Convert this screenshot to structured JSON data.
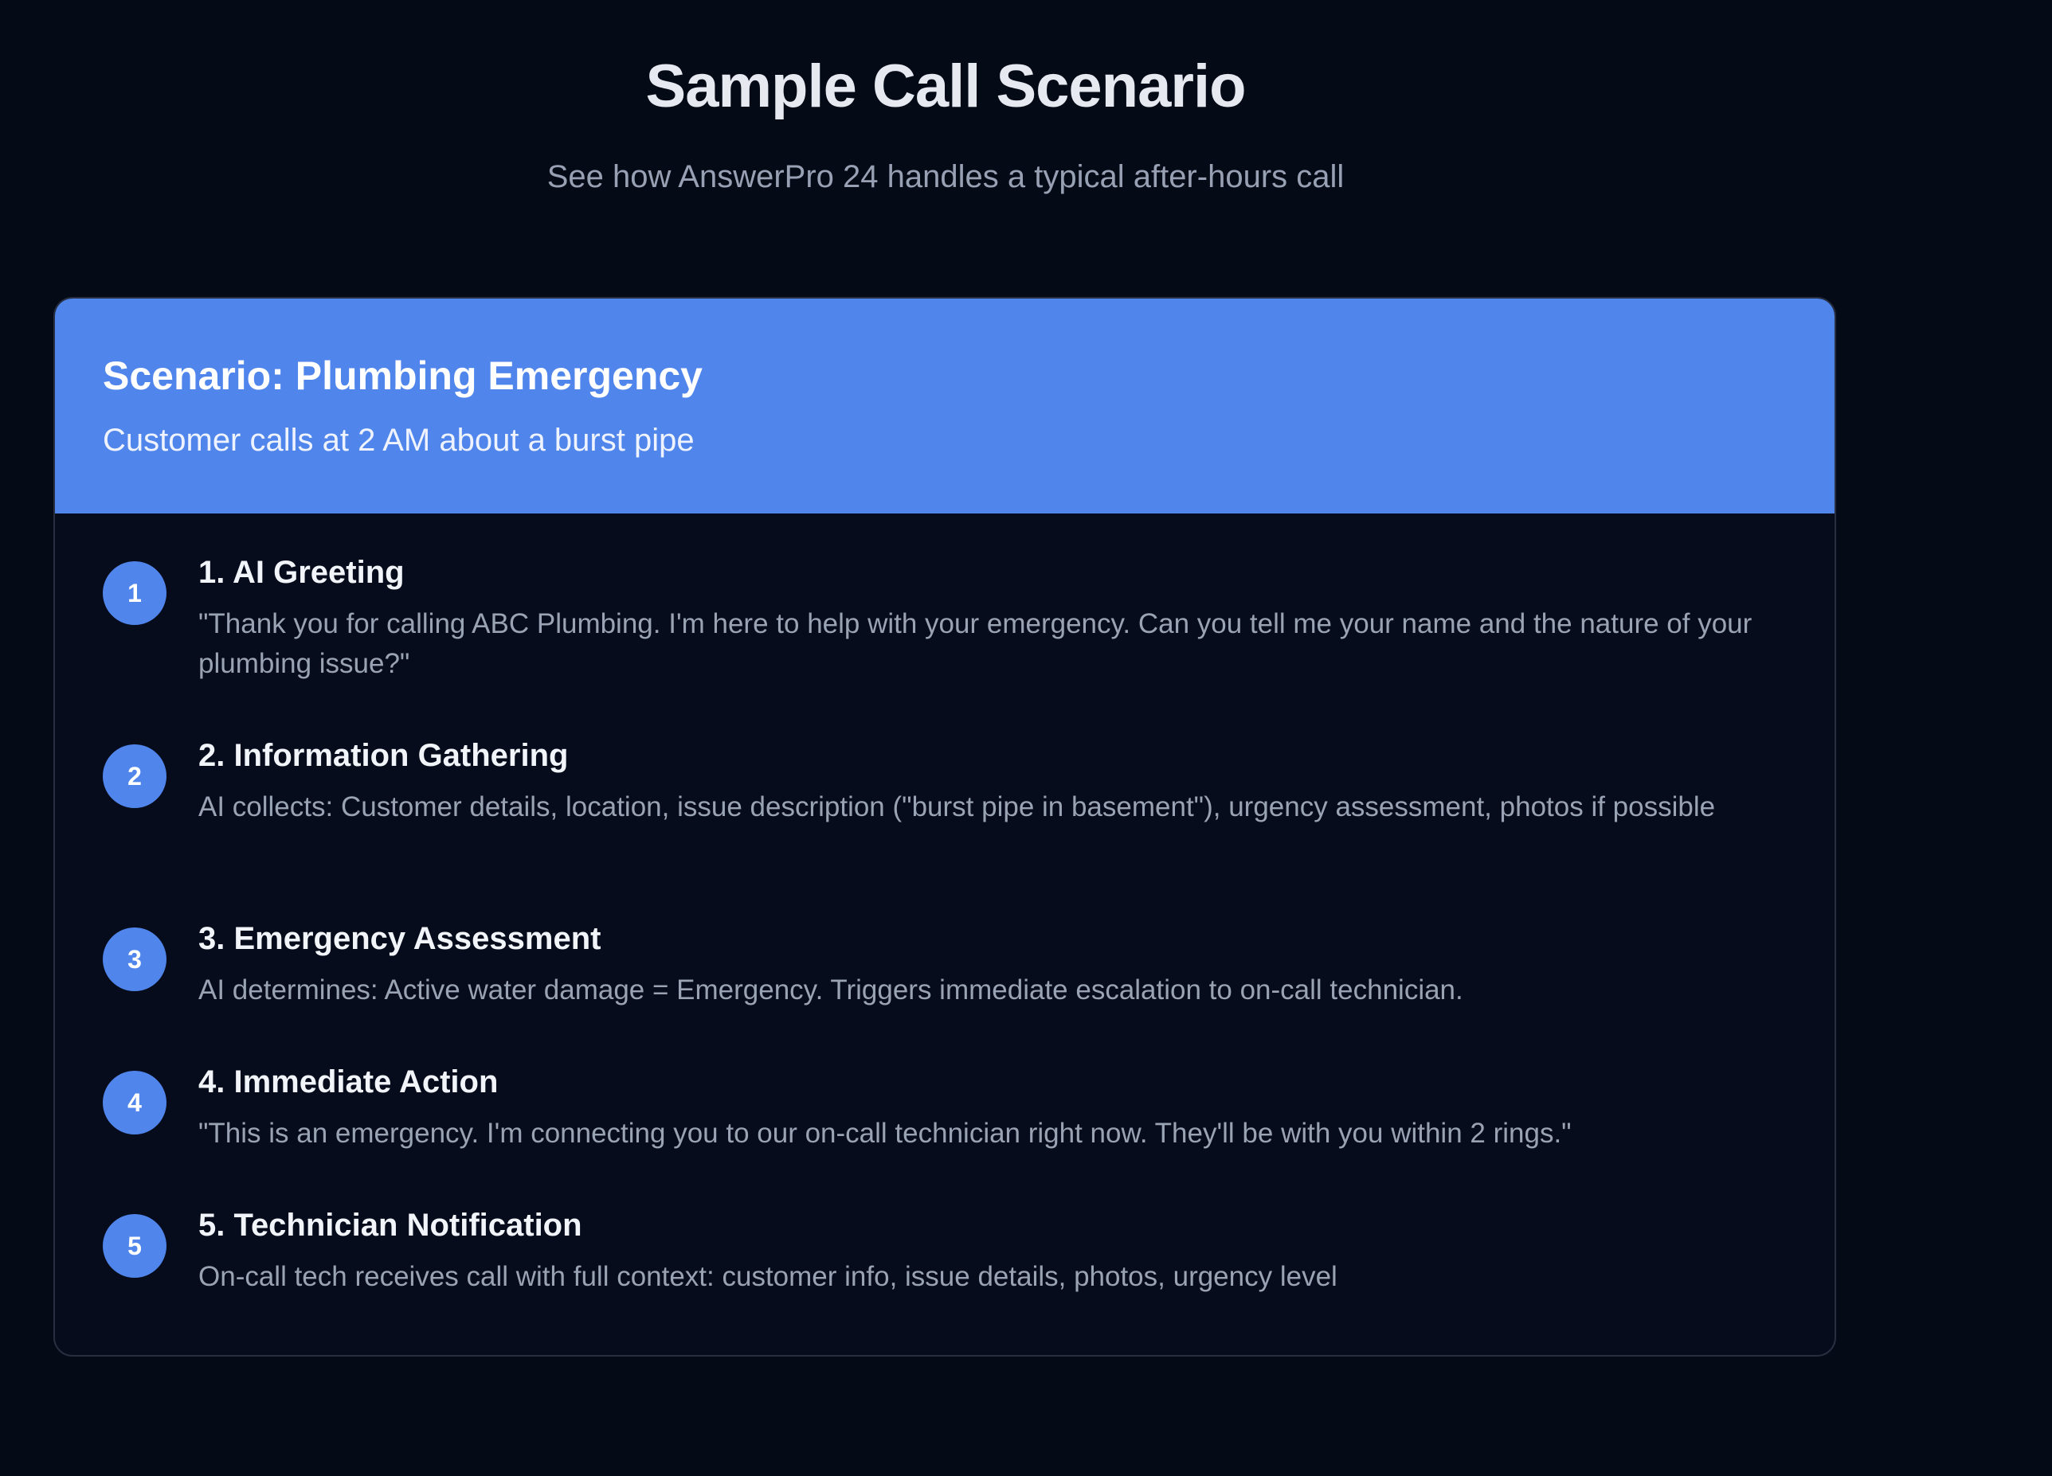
{
  "header": {
    "title": "Sample Call Scenario",
    "subtitle": "See how AnswerPro 24 handles a typical after-hours call"
  },
  "scenario": {
    "title": "Scenario: Plumbing Emergency",
    "subtitle": "Customer calls at 2 AM about a burst pipe",
    "steps": [
      {
        "number": "1",
        "title": "1. AI Greeting",
        "description": "\"Thank you for calling ABC Plumbing. I'm here to help with your emergency. Can you tell me your name and the nature of your plumbing issue?\""
      },
      {
        "number": "2",
        "title": "2. Information Gathering",
        "description": "AI collects: Customer details, location, issue description (\"burst pipe in basement\"), urgency assessment, photos if possible"
      },
      {
        "number": "3",
        "title": "3. Emergency Assessment",
        "description": "AI determines: Active water damage = Emergency. Triggers immediate escalation to on-call technician."
      },
      {
        "number": "4",
        "title": "4. Immediate Action",
        "description": "\"This is an emergency. I'm connecting you to our on-call technician right now. They'll be with you within 2 rings.\""
      },
      {
        "number": "5",
        "title": "5. Technician Notification",
        "description": "On-call tech receives call with full context: customer info, issue details, photos, urgency level"
      }
    ]
  },
  "colors": {
    "background": "#050a17",
    "accent": "#5086ec",
    "text_primary": "#e6e9ef",
    "text_secondary": "#98a1b3"
  }
}
